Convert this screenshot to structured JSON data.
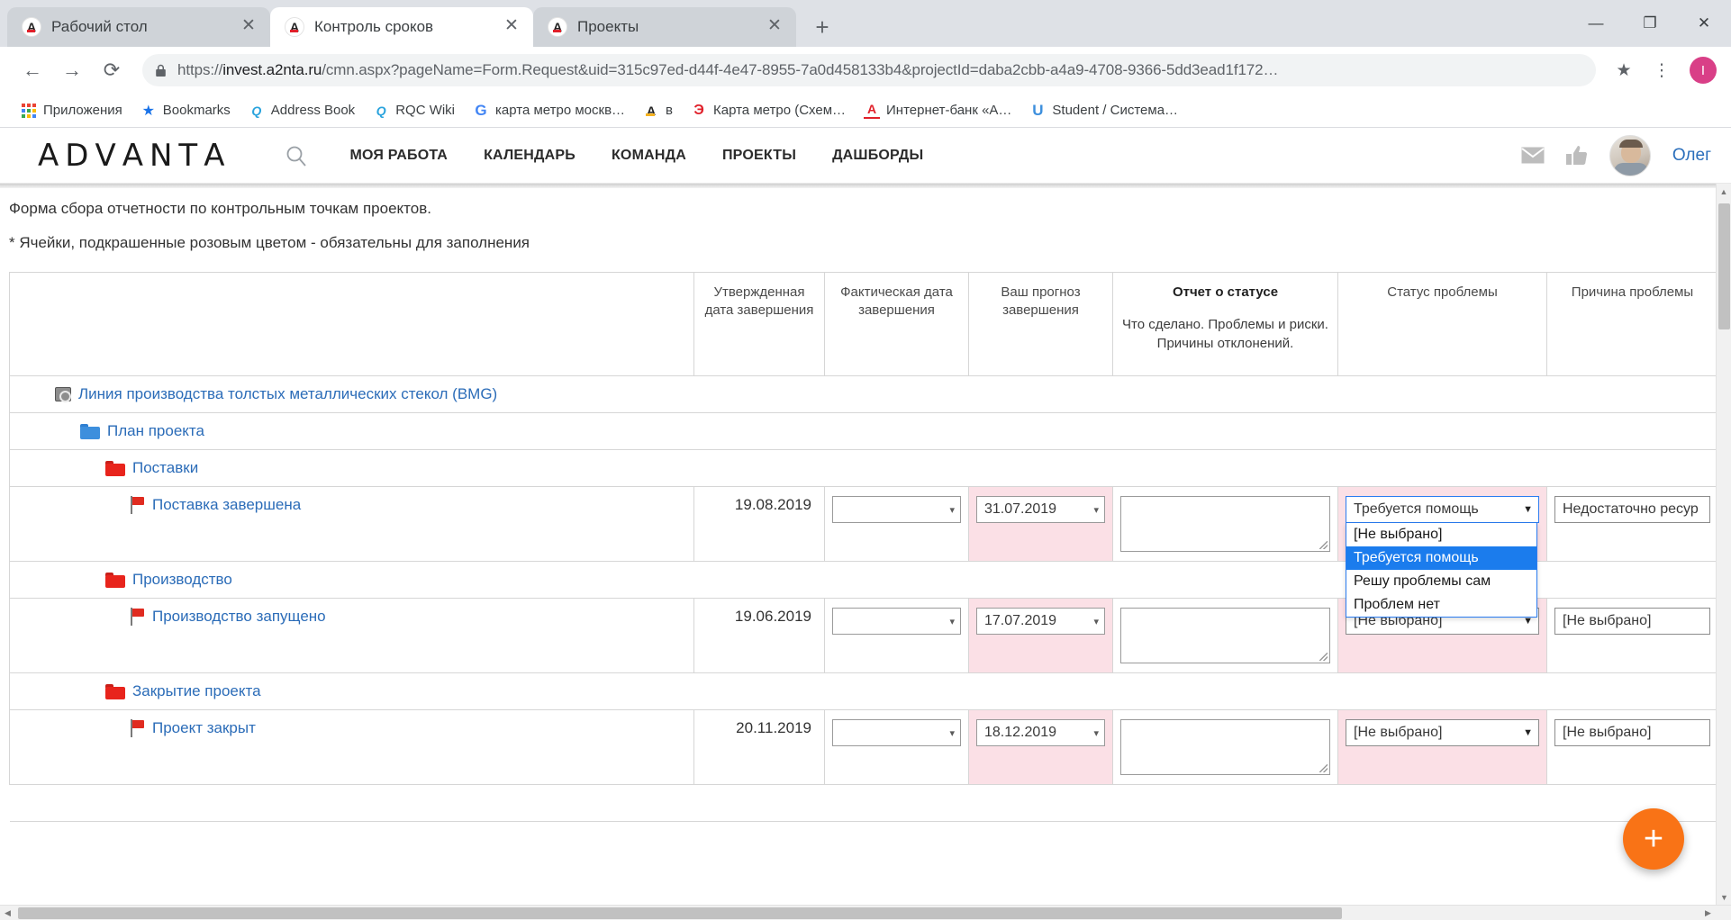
{
  "browser": {
    "tabs": [
      {
        "title": "Рабочий стол",
        "active": false,
        "icon": "advanta-favicon",
        "close": "✕"
      },
      {
        "title": "Контроль сроков",
        "active": true,
        "icon": "advanta-favicon",
        "close": "✕"
      },
      {
        "title": "Проекты",
        "active": false,
        "icon": "advanta-favicon",
        "close": "✕"
      }
    ],
    "new_tab_label": "+",
    "window_controls": {
      "minimize": "—",
      "maximize": "❐",
      "close": "✕"
    },
    "nav": {
      "back": "←",
      "forward": "→",
      "reload": "⟳"
    },
    "omnibox": {
      "lock_icon": "lock-icon",
      "scheme": "https://",
      "host": "invest.a2nta.ru",
      "path": "/cmn.aspx?pageName=Form.Request&uid=315c97ed-d44f-4e47-8955-7a0d458133b4&projectId=daba2cbb-a4a9-4708-9366-5dd3ead1f172…",
      "star_icon": "★",
      "profile_initial": "I",
      "menu_icon": "⋮"
    },
    "bookmarks": [
      {
        "label": "Приложения",
        "icon": "apps-grid-icon"
      },
      {
        "label": "Bookmarks",
        "icon": "star-icon"
      },
      {
        "label": "Address Book",
        "icon": "qrc-icon"
      },
      {
        "label": "RQC Wiki",
        "icon": "qrc-icon"
      },
      {
        "label": "карта метро москв…",
        "icon": "google-icon"
      },
      {
        "label": "в",
        "icon": "advanta-icon"
      },
      {
        "label": "Карта метро (Схем…",
        "icon": "yandex-icon"
      },
      {
        "label": "Интернет-банк «А…",
        "icon": "alfabank-icon"
      },
      {
        "label": "Student / Система…",
        "icon": "u-icon"
      }
    ]
  },
  "app": {
    "logo": {
      "letters": [
        "A",
        "D",
        "V",
        "A",
        "N",
        "T",
        "A"
      ],
      "colors": {
        "first_a": "#f5b220",
        "second_a": "#e0202a",
        "last_a": "#3d8fdd"
      }
    },
    "search_icon": "search-icon",
    "nav_items": [
      {
        "label": "МОЯ РАБОТА"
      },
      {
        "label": "КАЛЕНДАРЬ"
      },
      {
        "label": "КОМАНДА"
      },
      {
        "label": "ПРОЕКТЫ"
      },
      {
        "label": "ДАШБОРДЫ"
      }
    ],
    "mail_icon": "mail-icon",
    "like_icon": "thumbs-up-icon",
    "user_name": "Олег"
  },
  "form": {
    "title": "Форма сбора отчетности по контрольным точкам проектов.",
    "note": "* Ячейки, подкрашенные розовым цветом - обязательны для заполнения",
    "columns": {
      "tree": "",
      "approved_date": "Утвержденная дата завершения",
      "actual_date": "Фактическая дата завершения",
      "forecast_date": "Ваш прогноз завершения",
      "status_report_title": "Отчет о статусе",
      "status_report_sub": "Что сделано. Проблемы и риски. Причины отклонений.",
      "problem_status": "Статус проблемы",
      "problem_reason": "Причина проблемы"
    },
    "project": {
      "label": "Линия производства толстых металлических стекол (BMG)",
      "icon": "project-icon"
    },
    "plan": {
      "label": "План проекта",
      "icon": "folder-blue-icon"
    },
    "groups": [
      {
        "label": "Поставки",
        "icon": "folder-red-icon",
        "milestone": {
          "label": "Поставка завершена",
          "icon": "flag-icon",
          "approved_date": "19.08.2019",
          "actual_date": "",
          "forecast_date": "31.07.2019",
          "status_report": "",
          "problem_status": "Требуется помощь",
          "problem_reason": "Недостаточно ресур",
          "dropdown_open": true
        }
      },
      {
        "label": "Производство",
        "icon": "folder-red-icon",
        "milestone": {
          "label": "Производство запущено",
          "icon": "flag-icon",
          "approved_date": "19.06.2019",
          "actual_date": "",
          "forecast_date": "17.07.2019",
          "status_report": "",
          "problem_status": "[Не выбрано]",
          "problem_reason": "[Не выбрано]",
          "dropdown_open": false
        }
      },
      {
        "label": "Закрытие проекта",
        "icon": "folder-red-icon",
        "milestone": {
          "label": "Проект закрыт",
          "icon": "flag-icon",
          "approved_date": "20.11.2019",
          "actual_date": "",
          "forecast_date": "18.12.2019",
          "status_report": "",
          "problem_status": "[Не выбрано]",
          "problem_reason": "[Не выбрано]",
          "dropdown_open": false
        }
      }
    ],
    "problem_status_options": [
      {
        "label": "[Не выбрано]",
        "selected": false
      },
      {
        "label": "Требуется помощь",
        "selected": true
      },
      {
        "label": "Решу проблемы сам",
        "selected": false
      },
      {
        "label": "Проблем нет",
        "selected": false
      }
    ],
    "date_caret": "▾",
    "select_caret": "▼",
    "add_button_label": "+",
    "required_cell_color": "#fbe0e6",
    "accent_color": "#f97316"
  }
}
